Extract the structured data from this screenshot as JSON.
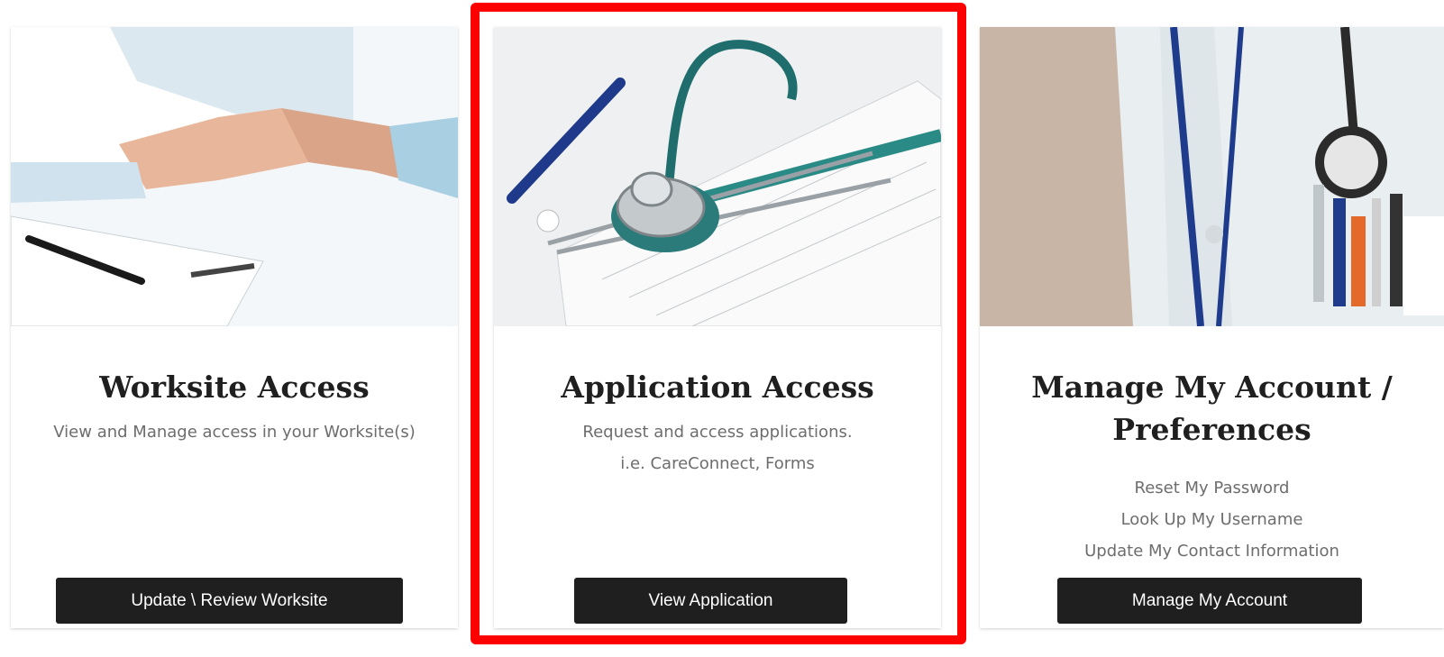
{
  "cards": [
    {
      "title": "Worksite Access",
      "description": [
        "View and Manage access in your Worksite(s)"
      ],
      "button": "Update \\ Review Worksite"
    },
    {
      "title": "Application Access",
      "description": [
        "Request and access applications.",
        "i.e. CareConnect, Forms"
      ],
      "button": "View Application"
    },
    {
      "title_lines": [
        "Manage My Account /",
        "Preferences"
      ],
      "links": [
        "Reset My Password",
        "Look Up My Username",
        "Update My Contact Information"
      ],
      "button": "Manage My Account"
    }
  ],
  "colors": {
    "button_bg": "#1f1f1f",
    "highlight": "#ff0000",
    "title": "#1f1f1f",
    "desc": "#6d6d6d"
  }
}
